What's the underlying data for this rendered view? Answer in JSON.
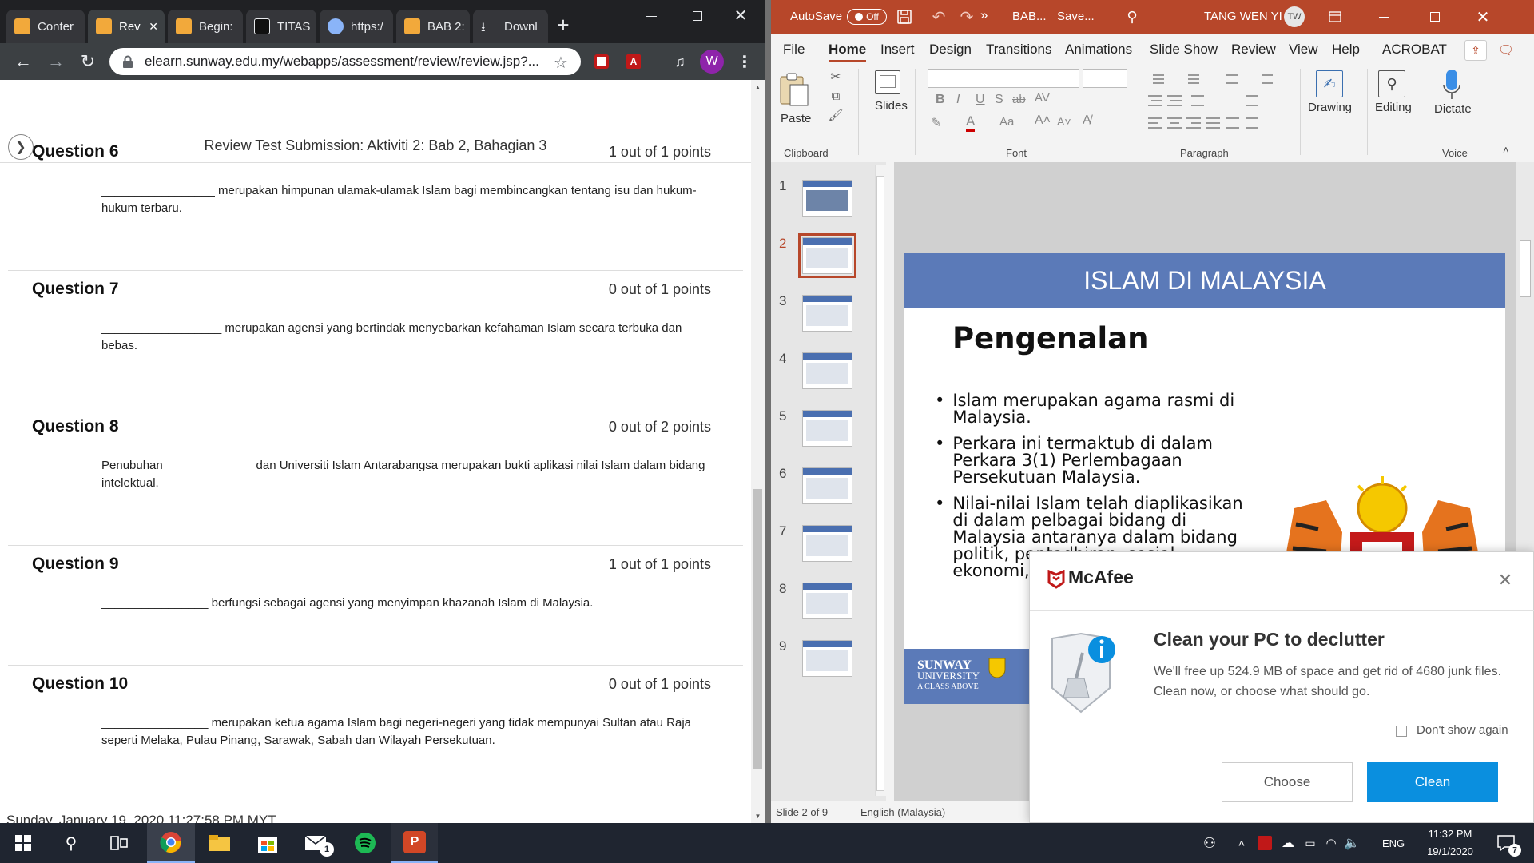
{
  "chrome": {
    "tabs": [
      {
        "label": "Conter",
        "icon": "blackboard-icon",
        "color": "#f2a93b"
      },
      {
        "label": "Rev",
        "icon": "blackboard-icon",
        "color": "#f2a93b"
      },
      {
        "label": "Begin:",
        "icon": "blackboard-icon",
        "color": "#f2a93b"
      },
      {
        "label": "TITAS",
        "icon": "bb-icon",
        "color": "#111111"
      },
      {
        "label": "https:/",
        "icon": "globe-icon",
        "color": "#8ab4f8"
      },
      {
        "label": "BAB 2:",
        "icon": "blackboard-icon",
        "color": "#f2a93b"
      },
      {
        "label": "Downl",
        "icon": "download-icon",
        "color": "#e8eaed"
      }
    ],
    "url": "elearn.sunway.edu.my/webapps/assessment/review/review.jsp?...",
    "profile_initial": "W"
  },
  "review": {
    "title": "Review Test Submission: Aktiviti 2: Bab 2, Bahagian 3",
    "questions": [
      {
        "label": "Question 6",
        "points": "1 out of 1 points",
        "text": "_________________ merupakan himpunan ulamak-ulamak Islam bagi membincangkan tentang isu dan hukum-hukum terbaru."
      },
      {
        "label": "Question 7",
        "points": "0 out of 1 points",
        "text": "__________________ merupakan agensi yang bertindak menyebarkan kefahaman Islam secara terbuka dan bebas."
      },
      {
        "label": "Question 8",
        "points": "0 out of 2 points",
        "text": "Penubuhan _____________ dan Universiti Islam Antarabangsa merupakan bukti aplikasi nilai Islam dalam bidang intelektual."
      },
      {
        "label": "Question 9",
        "points": "1 out of 1 points",
        "text": "________________ berfungsi sebagai agensi yang menyimpan khazanah Islam di Malaysia."
      },
      {
        "label": "Question 10",
        "points": "0 out of 1 points",
        "text": "________________ merupakan ketua agama Islam bagi negeri-negeri yang tidak mempunyai Sultan atau Raja seperti Melaka, Pulau Pinang, Sarawak, Sabah dan Wilayah Persekutuan."
      }
    ],
    "footer_timestamp": "Sunday, January 19, 2020 11:27:58 PM MYT"
  },
  "ppt": {
    "autosave_label": "AutoSave",
    "autosave_state": "Off",
    "file_name": "BAB...",
    "save_status": "Save...",
    "user_name": "TANG WEN YI",
    "user_initials": "TW",
    "ribbon_tabs": [
      "File",
      "Home",
      "Insert",
      "Design",
      "Transitions",
      "Animations",
      "Slide Show",
      "Review",
      "View",
      "Help",
      "ACROBAT"
    ],
    "active_tab": "Home",
    "groups": {
      "clipboard": "Clipboard",
      "paste": "Paste",
      "slides": "Slides",
      "font": "Font",
      "paragraph": "Paragraph",
      "drawing": "Drawing",
      "editing": "Editing",
      "dictate": "Dictate",
      "voice": "Voice"
    },
    "thumbnails": [
      "1",
      "2",
      "3",
      "4",
      "5",
      "6",
      "7",
      "8",
      "9"
    ],
    "selected_slide": "2",
    "slide": {
      "banner": "ISLAM DI MALAYSIA",
      "heading": "Pengenalan",
      "bullets": [
        "Islam merupakan agama rasmi di Malaysia.",
        "Perkara ini termaktub di dalam Perkara 3(1) Perlembagaan Persekutuan Malaysia.",
        "Nilai-nilai Islam telah diaplikasikan di dalam pelbagai bidang di Malaysia antaranya  dalam bidang politik, pentadbiran, sosial, ekonomi, Intelektual"
      ],
      "logo_line1": "SUNWAY",
      "logo_line2": "UNIVERSITY",
      "logo_tagline": "A CLASS ABOVE"
    },
    "status": {
      "slide_info": "Slide 2 of 9",
      "language": "English (Malaysia)"
    },
    "accent": "#b7472a",
    "banner_color": "#5b7ab8"
  },
  "mcafee": {
    "brand": "McAfee",
    "heading": "Clean your PC to declutter",
    "body": "We'll free up 524.9 MB of space and get rid of 4680 junk files. Clean now, or choose what should go.",
    "dont_show": "Don't show again",
    "choose": "Choose",
    "clean": "Clean",
    "brand_color": "#c01818",
    "button_color": "#0a8fdf"
  },
  "taskbar": {
    "language": "ENG",
    "time": "11:32 PM",
    "date": "19/1/2020",
    "notification_count": "7",
    "mail_badge": "1"
  }
}
